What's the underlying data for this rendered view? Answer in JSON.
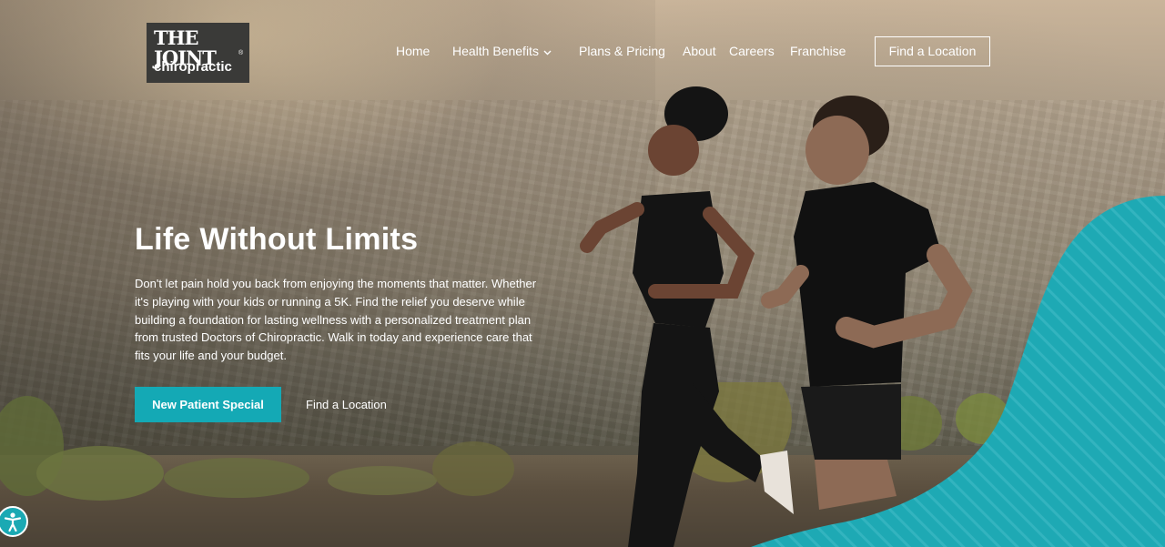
{
  "brand": {
    "logo_line1": "THE JOINT",
    "logo_line2": "chiropractic",
    "logo_reg": "®"
  },
  "nav": {
    "items": [
      "Home",
      "Health Benefits",
      "Plans & Pricing",
      "About",
      "Careers",
      "Franchise"
    ],
    "dropdown_item": "Health Benefits",
    "cta": "Find a Location"
  },
  "hero": {
    "title": "Life Without Limits",
    "body": "Don't let pain hold you back from enjoying the moments that matter. Whether it's playing with your kids or running a 5K. Find the relief you deserve while building a foundation for lasting wellness with a personalized treatment plan from trusted Doctors of Chiropractic. Walk in today and experience care that fits your life and your budget.",
    "primary_cta": "New Patient Special",
    "secondary_cta": "Find a Location"
  },
  "icons": {
    "dropdown": "chevron-down-icon",
    "accessibility": "accessibility-icon"
  },
  "colors": {
    "accent_teal": "#14a9b5",
    "logo_bg": "#3a3a38"
  }
}
